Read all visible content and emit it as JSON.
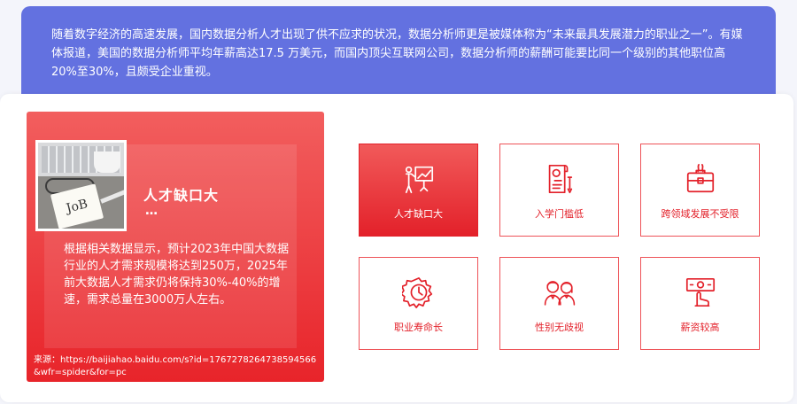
{
  "banner": {
    "text": "随着数字经济的高速发展，国内数据分析人才出现了供不应求的状况，数据分析师更是被媒体称为“未来最具发展潜力的职业之一”。有媒体报道，美国的数据分析师平均年薪高达17.5 万美元，而国内顶尖互联网公司，数据分析师的薪酬可能要比同一个级别的其他职位高20%至30%，且颇受企业重视。"
  },
  "feature": {
    "photo_note": "JoB",
    "title": "人才缺口大",
    "dots": "…",
    "text": "根据相关数据显示，预计2023年中国大数据行业的人才需求规模将达到250万，2025年前大数据人才需求仍将保持30%-40%的增速，需求总量在3000万人左右。",
    "source": "来源：https://baijiahao.baidu.com/s?id=1767278264738594566&wfr=spider&for=pc"
  },
  "tiles": [
    {
      "label": "人才缺口大",
      "icon": "presentation-chart-icon",
      "active": true
    },
    {
      "label": "入学门槛低",
      "icon": "certificate-icon",
      "active": false
    },
    {
      "label": "跨领域发展不受限",
      "icon": "briefcase-icon",
      "active": false
    },
    {
      "label": "职业寿命长",
      "icon": "gear-clock-icon",
      "active": false
    },
    {
      "label": "性别无歧视",
      "icon": "male-female-icon",
      "active": false
    },
    {
      "label": "薪资较高",
      "icon": "money-hand-icon",
      "active": false
    }
  ],
  "colors": {
    "banner_bg": "#6371e0",
    "accent_red": "#e3212a",
    "panel_gradient_top": "#f25e5e"
  }
}
